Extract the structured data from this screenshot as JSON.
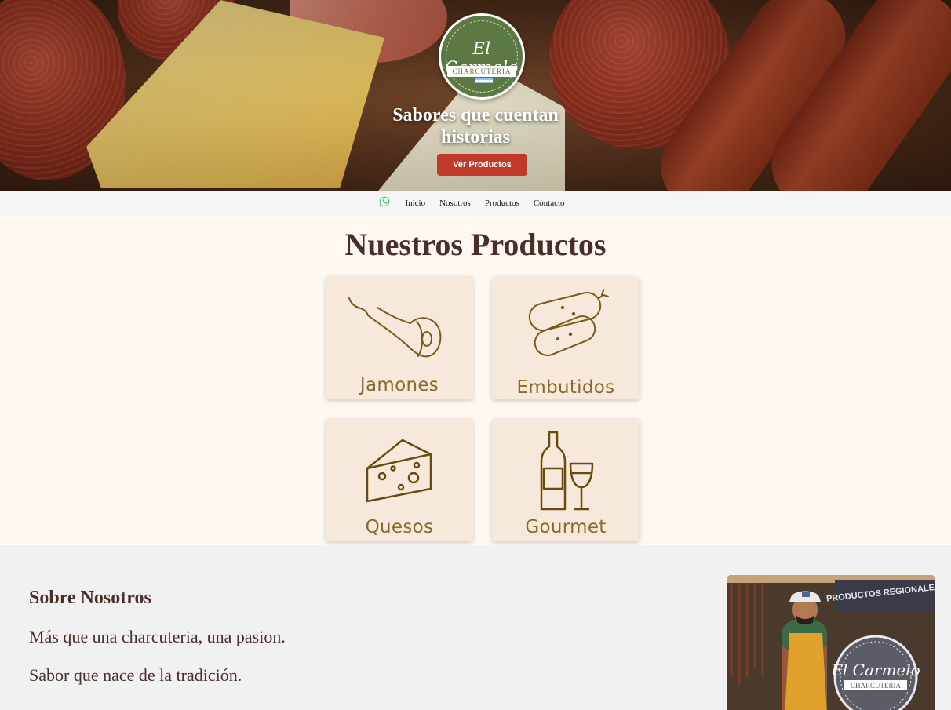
{
  "hero": {
    "logo_script": "El Carmelo",
    "logo_banner": "CHARCUTERIA",
    "title_line1": "Sabores que cuentan",
    "title_line2": "historias",
    "button_label": "Ver Productos"
  },
  "nav": {
    "items": [
      {
        "label": "Inicio"
      },
      {
        "label": "Nosotros"
      },
      {
        "label": "Productos"
      },
      {
        "label": "Contacto"
      }
    ],
    "whatsapp_icon": "whatsapp-icon"
  },
  "products": {
    "heading": "Nuestros Productos",
    "cards": [
      {
        "label": "Jamones",
        "icon": "ham-icon"
      },
      {
        "label": "Embutidos",
        "icon": "sausage-icon"
      },
      {
        "label": "Quesos",
        "icon": "cheese-icon"
      },
      {
        "label": "Gourmet",
        "icon": "wine-icon"
      }
    ]
  },
  "about": {
    "heading": "Sobre Nosotros",
    "line1": "Más que una charcuteria, una pasion.",
    "line2": "Sabor que nace de la tradición.",
    "photo_sign": "PRODUCTOS REGIONALES",
    "photo_logo": "El Carmelo",
    "photo_logo_sub": "CHARCUTERIA"
  },
  "colors": {
    "accent_red": "#c0392b",
    "brand_green": "#5b7a43",
    "heading_brown": "#4a2e27",
    "icon_gold": "#8a6a2a"
  }
}
